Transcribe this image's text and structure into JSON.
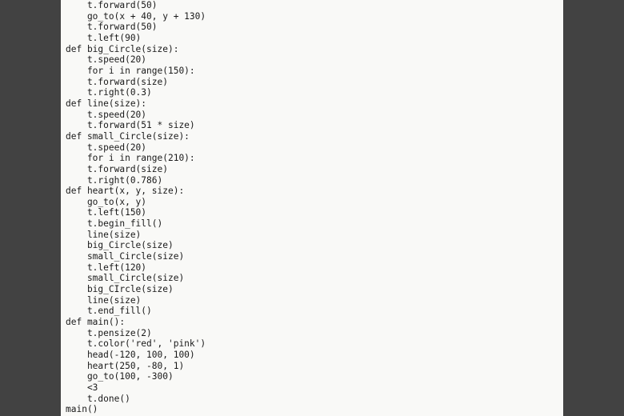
{
  "code_lines": [
    "    t.forward(50)",
    "    go_to(x + 40, y + 130)",
    "    t.forward(50)",
    "    t.left(90)",
    "def big_Circle(size):",
    "    t.speed(20)",
    "    for i in range(150):",
    "    t.forward(size)",
    "    t.right(0.3)",
    "def line(size):",
    "    t.speed(20)",
    "    t.forward(51 * size)",
    "def small_Circle(size):",
    "    t.speed(20)",
    "    for i in range(210):",
    "    t.forward(size)",
    "    t.right(0.786)",
    "def heart(x, y, size):",
    "    go_to(x, y)",
    "    t.left(150)",
    "    t.begin_fill()",
    "    line(size)",
    "    big_Circle(size)",
    "    small_Circle(size)",
    "    t.left(120)",
    "    small_Circle(size)",
    "    big_CIrcle(size)",
    "    line(size)",
    "    t.end_fill()",
    "def main():",
    "    t.pensize(2)",
    "    t.color('red', 'pink')",
    "    head(-120, 100, 100)",
    "    heart(250, -80, 1)",
    "    go_to(100, -300)",
    "    <3",
    "    t.done()",
    "main()"
  ]
}
